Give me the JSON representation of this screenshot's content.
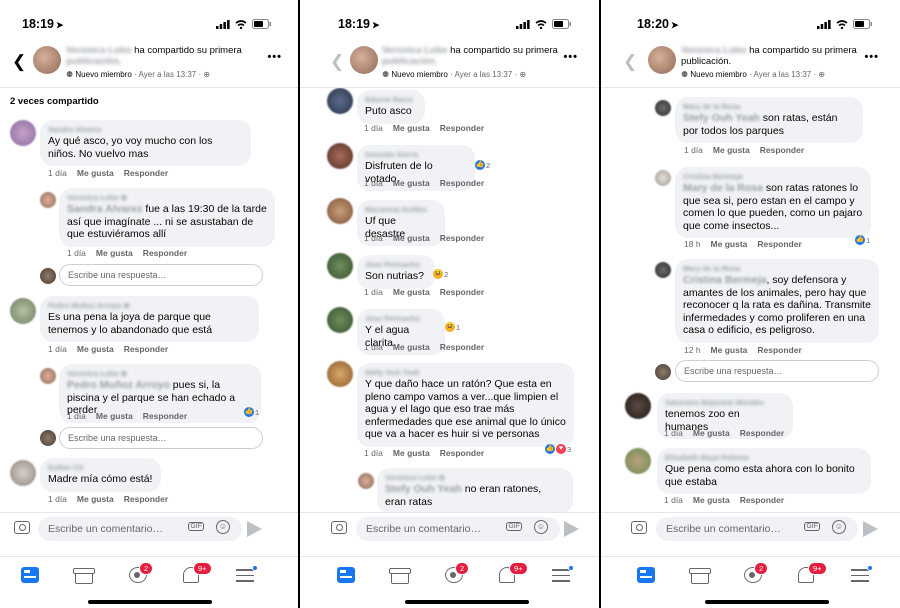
{
  "common": {
    "header_action": "ha compartido su primera",
    "publicacion": "publicación.",
    "poster_blurred": "Veronica Lobo",
    "member": "Nuevo miembro",
    "posted_time": "Ayer a las 13:37",
    "globe_icon": "globe-icon",
    "composer_placeholder": "Escribe un comentario…",
    "reply_placeholder": "Escribe una respuesta…",
    "gif": "GIF",
    "like": "Me gusta",
    "reply": "Responder",
    "groups_badge": "2",
    "notif_badge": "9+",
    "accent": "#1877f2"
  },
  "panel1": {
    "time": "18:19",
    "shared_count": "2 veces compartido",
    "c1": {
      "name": "Sandra Alvarez",
      "text": "Ay qué asco, yo voy mucho con los niños. No vuelvo mas",
      "time": "1 día"
    },
    "r1": {
      "name": "Veronica Lobo ⊕",
      "tag": "Sandra Alvarez",
      "text": " fue a las 19:30 de la tarde así que imagínate ... ni se asustaban de que estuviéramos allí",
      "time": "1 día"
    },
    "c2": {
      "name": "Pedro Muñoz Arroyo ⊕",
      "text": "Es una pena la joya de parque que tenemos y lo abandonado que está",
      "time": "1 día"
    },
    "r2": {
      "name": "Veronica Lobo ⊕",
      "tag": "Pedro Muñoz Arroyo",
      "text": " pues si, la piscina y el parque se han echado a perder",
      "time": "1 día",
      "reacts": "1"
    },
    "c3": {
      "name": "Esther Ch",
      "text": "Madre mía cómo está!",
      "time": "1 día"
    }
  },
  "panel2": {
    "time": "18:19",
    "c1": {
      "name": "Edurne Barra",
      "text": "Puto asco",
      "time": "1 día"
    },
    "c2": {
      "name": "Gonzalo Sierra",
      "text": "Disfruten de lo votado",
      "time": "1 día",
      "reacts": "2"
    },
    "c3": {
      "name": "Macarena Guillen",
      "text": "Uf que desastre",
      "time": "1 día"
    },
    "c4": {
      "name": "Jose Pericacho",
      "text": "Son nutrias?",
      "time": "1 día",
      "reacts": "2"
    },
    "c5": {
      "name": "Jose Pericacho",
      "text": "Y el agua clarita",
      "time": "1 día",
      "reacts": "1"
    },
    "c6": {
      "name": "Stefy Ouh Yeah",
      "text": "Y que daño hace un ratón? Que esta en pleno campo vamos a ver...que limpien el agua y el lago que eso trae más enfermedades que ese animal que lo único que va a hacer es huir si ve personas",
      "time": "1 día",
      "reacts": "3"
    },
    "r1": {
      "name": "Veronica Lobo ⊕",
      "tag": "Stefy Ouh Yeah",
      "text": " no eran ratones, eran ratas"
    }
  },
  "panel3": {
    "time": "18:20",
    "c1": {
      "name": "Mary de la Rosa",
      "tag": "Stefy Ouh Yeah",
      "text": " son ratas, están por todos los parques",
      "time": "1 día"
    },
    "c2": {
      "name": "Cristina Bermeja",
      "tag": "Mary de la Rosa",
      "text": " son ratas ratones lo que sea si, pero estan en el campo y comen lo que pueden, como un pajaro que come insectos...",
      "time": "18 h",
      "reacts": "1"
    },
    "c3": {
      "name": "Mary de la Rosa",
      "tag": "Cristina Bermeja",
      "text": ", soy defensora y amantes de los animales, pero hay que reconocer q la rata es dañina. Transmite infermedades y como proliferen en una casa o edificio, es peligroso.",
      "time": "12 h"
    },
    "c4": {
      "name": "Saturiano Bejarano Morales",
      "text": "tenemos zoo en humanes",
      "time": "1 día"
    },
    "c5": {
      "name": "Elisabeth Mayo Palomo",
      "text": "Que pena como esta ahora    con lo bonito que estaba",
      "time": "1 día"
    }
  }
}
